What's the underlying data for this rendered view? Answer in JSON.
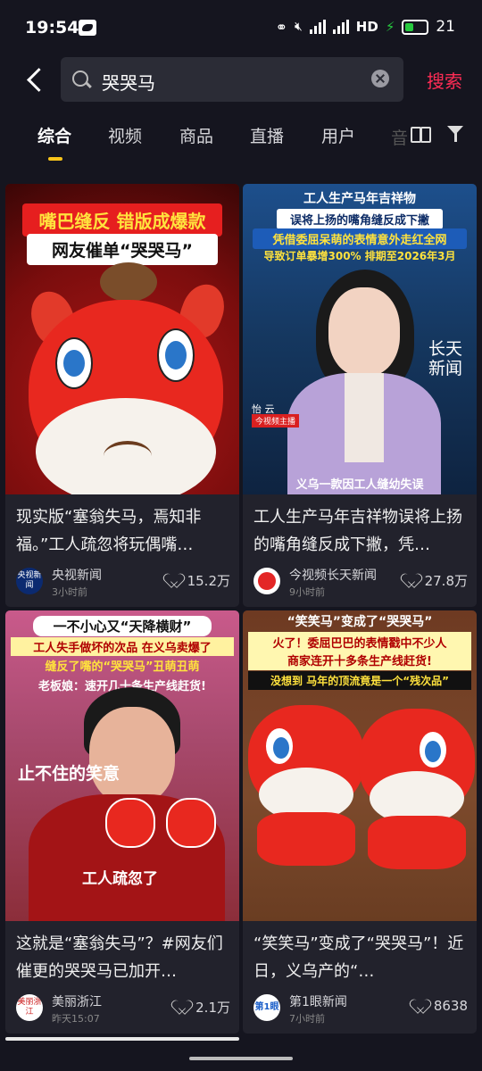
{
  "status": {
    "time": "19:54",
    "net1": "5G",
    "net2": "5GA",
    "hd": "HD",
    "battery": "21"
  },
  "search": {
    "query": "哭哭马",
    "button": "搜索"
  },
  "tabs": [
    "综合",
    "视频",
    "商品",
    "直播",
    "用户",
    "音"
  ],
  "cards": [
    {
      "thumb_line1": "嘴巴缝反 错版成爆款",
      "thumb_line2": "网友催单“哭哭马”",
      "caption": "现实版“塞翁失马，焉知非福。”工人疏忽将玩偶嘴…",
      "author": "央视新闻",
      "avatar_text": "央视新闻",
      "time": "3小时前",
      "likes": "15.2万"
    },
    {
      "thumb_line1": "工人生产马年吉祥物",
      "thumb_line2": "误将上扬的嘴角缝反成下撇",
      "thumb_line3": "凭借委屈呆萌的表情意外走红全网",
      "thumb_line4": "导致订单暴增300% 排期至2026年3月",
      "thumb_logo": "长天新闻",
      "thumb_name": "怡 云",
      "thumb_role": "今视频主播",
      "thumb_bottom": "义乌一款因工人缝幼失误",
      "caption": "工人生产马年吉祥物误将上扬的嘴角缝反成下撇，凭…",
      "author": "今视频长天新闻",
      "time": "9小时前",
      "likes": "27.8万"
    },
    {
      "thumb_line1": "一不小心又“天降横财”",
      "thumb_line2": "工人失手做坏的次品 在义乌卖爆了",
      "thumb_line3": "缝反了嘴的“哭哭马”丑萌丑萌",
      "thumb_line4": "老板娘：速开几十条生产线赶货!",
      "thumb_side": "止不住的笑意",
      "thumb_bottom": "工人疏忽了",
      "caption": "这就是“塞翁失马”？#网友们催更的哭哭马已加开…",
      "author": "美丽浙江",
      "avatar_text": "美丽浙江",
      "time": "昨天15:07",
      "likes": "2.1万"
    },
    {
      "thumb_line1": "“笑笑马”变成了“哭哭马”",
      "thumb_line2": "火了！委屈巴巴的表情戳中不少人",
      "thumb_line3": "商家连开十多条生产线赶货!",
      "thumb_line4": "没想到 马年的顶流竟是一个“残次品”",
      "caption": "“笑笑马”变成了“哭哭马”！近日，义乌产的“…",
      "author": "第1眼新闻",
      "avatar_text": "第1眼",
      "time": "7小时前",
      "likes": "8638"
    }
  ],
  "colors": {
    "accent": "#fe2c55",
    "tab_indicator": "#f8c41a",
    "background": "#15151f",
    "card": "#22222c"
  }
}
